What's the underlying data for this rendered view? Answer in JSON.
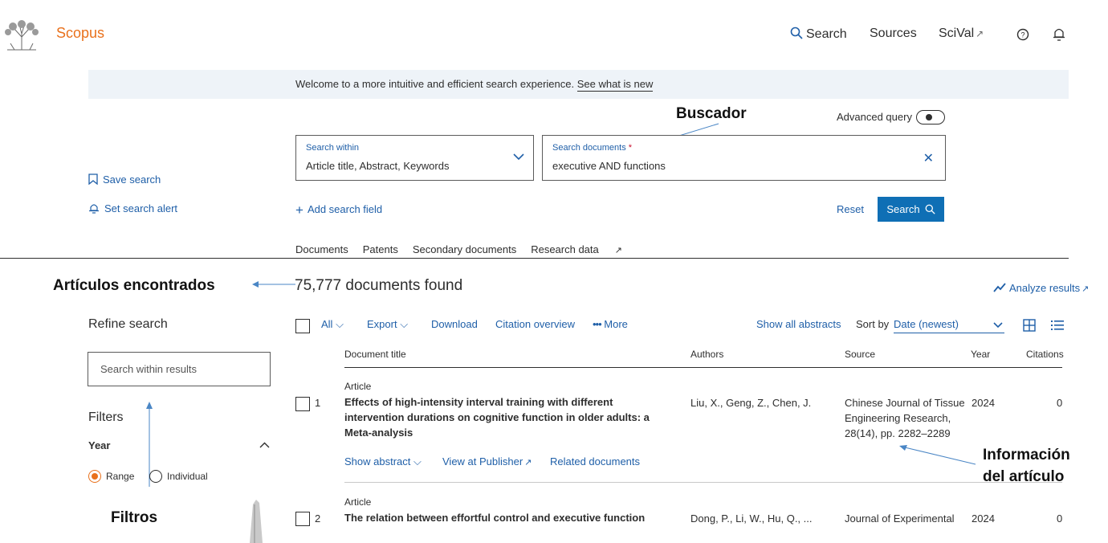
{
  "brand": "Scopus",
  "topnav": {
    "search": "Search",
    "sources": "Sources",
    "scival": "SciVal",
    "ext": "↗"
  },
  "banner": {
    "text": "Welcome to a more intuitive and efficient search experience. ",
    "link": "See what is new"
  },
  "annotations": {
    "buscador": "Buscador",
    "articulos": "Artículos encontrados",
    "informacion_1": "Información",
    "informacion_2": "del artículo",
    "filtros": "Filtros"
  },
  "advanced_query": "Advanced query",
  "search_within": {
    "label": "Search within",
    "value": "Article title, Abstract, Keywords"
  },
  "search_documents": {
    "label": "Search documents",
    "required": "*",
    "value": "executive AND functions"
  },
  "side": {
    "save_search": "Save search",
    "set_alert": "Set search alert"
  },
  "add_field": "Add search field",
  "reset": "Reset",
  "search_button": "Search",
  "tabs": [
    "Documents",
    "Patents",
    "Secondary documents",
    "Research data"
  ],
  "results_count": "75,777 documents found",
  "analyze": "Analyze results",
  "refine": {
    "title": "Refine search",
    "placeholder": "Search within results",
    "filters": "Filters",
    "year": "Year",
    "range": "Range",
    "individual": "Individual"
  },
  "toolbar": {
    "all": "All",
    "export": "Export",
    "download": "Download",
    "citation": "Citation overview",
    "more": "More",
    "show_abstracts": "Show all abstracts",
    "sort_by": "Sort by",
    "sort_value": "Date (newest)"
  },
  "columns": [
    "Document title",
    "Authors",
    "Source",
    "Year",
    "Citations"
  ],
  "rows": [
    {
      "num": "1",
      "type": "Article",
      "title": [
        "Effects of high-intensity interval training with different",
        "intervention durations on cognitive function in older adults: a",
        "Meta-analysis"
      ],
      "authors": "Liu, X., Geng, Z., Chen, J.",
      "source": [
        "Chinese Journal of Tissue",
        "Engineering Research,",
        "28(14), pp. 2282–2289"
      ],
      "year": "2024",
      "citations": "0",
      "actions": {
        "abstract": "Show abstract",
        "publisher": "View at Publisher",
        "related": "Related documents"
      }
    },
    {
      "num": "2",
      "type": "Article",
      "title": [
        "The relation between effortful control and executive function"
      ],
      "authors": "Dong, P., Li, W., Hu, Q., ...",
      "source": [
        "Journal of Experimental"
      ],
      "year": "2024",
      "citations": "0"
    }
  ],
  "colors": {
    "brand": "#e9711c",
    "link": "#1f5fa8",
    "primary": "#0f6fb5",
    "annot_arrow": "#4a86c5"
  }
}
